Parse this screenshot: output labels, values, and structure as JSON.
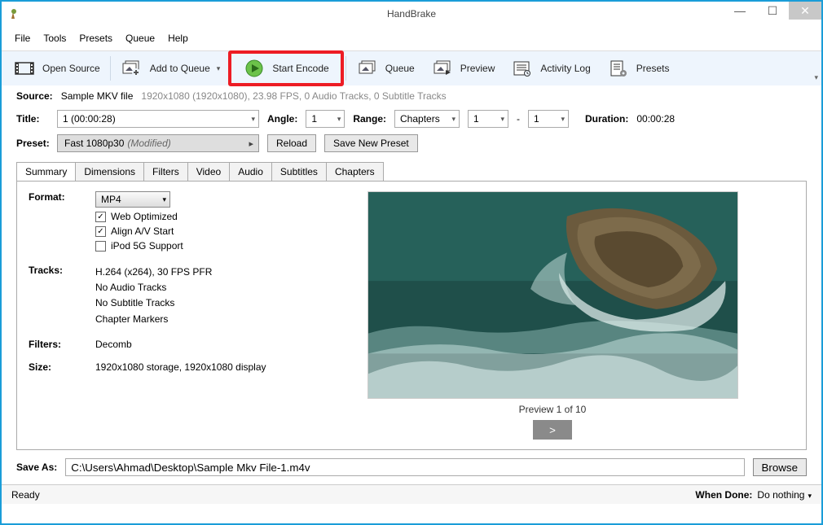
{
  "title": "HandBrake",
  "menubar": [
    "File",
    "Tools",
    "Presets",
    "Queue",
    "Help"
  ],
  "toolbar": {
    "open_source": "Open Source",
    "add_queue": "Add to Queue",
    "start_encode": "Start Encode",
    "queue": "Queue",
    "preview": "Preview",
    "activity": "Activity Log",
    "presets": "Presets"
  },
  "source": {
    "label": "Source:",
    "name": "Sample MKV file",
    "details": "1920x1080 (1920x1080), 23.98 FPS, 0 Audio Tracks, 0 Subtitle Tracks"
  },
  "title_row": {
    "label": "Title:",
    "value": "1 (00:00:28)",
    "angle_label": "Angle:",
    "angle_value": "1",
    "range_label": "Range:",
    "range_type": "Chapters",
    "range_from": "1",
    "range_dash": "-",
    "range_to": "1",
    "duration_label": "Duration:",
    "duration_value": "00:00:28"
  },
  "preset_row": {
    "label": "Preset:",
    "name": "Fast 1080p30",
    "modified": "(Modified)",
    "reload": "Reload",
    "save_new": "Save New Preset"
  },
  "tabs": [
    "Summary",
    "Dimensions",
    "Filters",
    "Video",
    "Audio",
    "Subtitles",
    "Chapters"
  ],
  "summary": {
    "format_label": "Format:",
    "format_value": "MP4",
    "web_optimized": "Web Optimized",
    "align_av": "Align A/V Start",
    "ipod": "iPod 5G Support",
    "tracks_label": "Tracks:",
    "tracks": [
      "H.264 (x264), 30 FPS PFR",
      "No Audio Tracks",
      "No Subtitle Tracks",
      "Chapter Markers"
    ],
    "filters_label": "Filters:",
    "filters_value": "Decomb",
    "size_label": "Size:",
    "size_value": "1920x1080 storage, 1920x1080 display"
  },
  "preview": {
    "label": "Preview 1 of 10",
    "nav": ">"
  },
  "save": {
    "label": "Save As:",
    "path": "C:\\Users\\Ahmad\\Desktop\\Sample Mkv File-1.m4v",
    "browse": "Browse"
  },
  "status": {
    "ready": "Ready",
    "when_done_label": "When Done:",
    "when_done_value": "Do nothing"
  }
}
